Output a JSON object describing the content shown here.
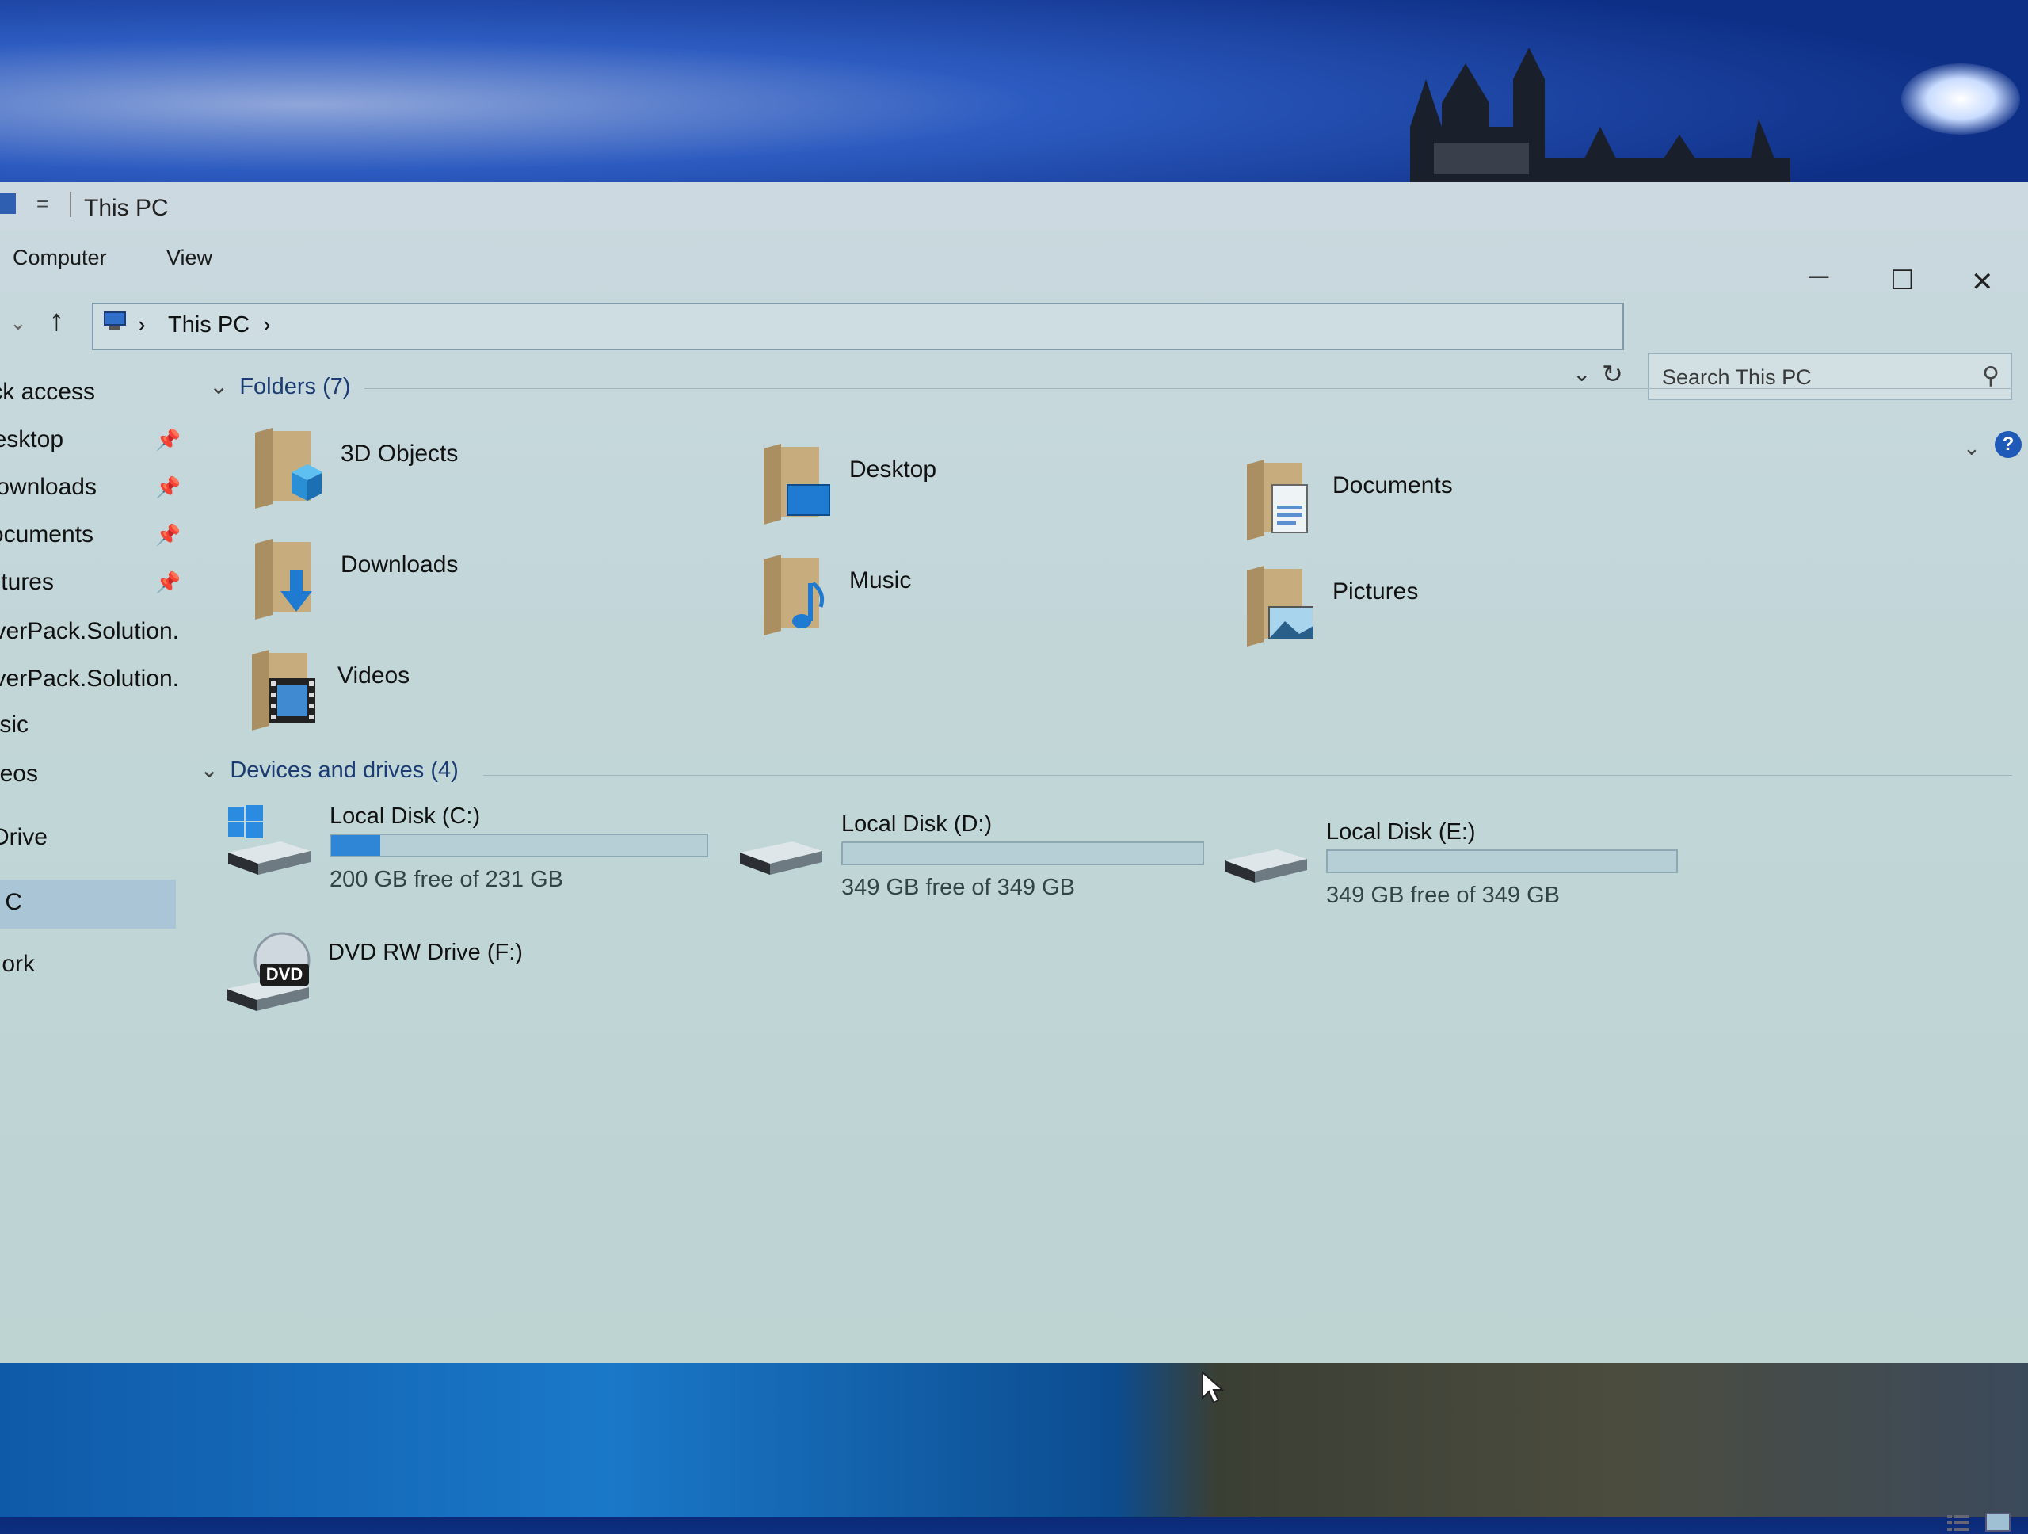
{
  "window": {
    "title": "This PC",
    "quick_access_menu": "=",
    "ribbon_tabs": [
      "Computer",
      "View"
    ],
    "controls": {
      "minimize": "─",
      "maximize": "☐",
      "close": "✕"
    }
  },
  "address": {
    "crumbs": [
      "This PC"
    ],
    "separator": "›",
    "search_placeholder": "Search This PC"
  },
  "sidebar": {
    "items": [
      {
        "label": "ck access",
        "pinned": false
      },
      {
        "label": "esktop",
        "pinned": true
      },
      {
        "label": "ownloads",
        "pinned": true
      },
      {
        "label": "ocuments",
        "pinned": true
      },
      {
        "label": "tures",
        "pinned": true
      },
      {
        "label": "verPack.Solution.",
        "pinned": false
      },
      {
        "label": "verPack.Solution.",
        "pinned": false
      },
      {
        "label": "sic",
        "pinned": false
      },
      {
        "label": "eos",
        "pinned": false
      },
      {
        "label": "Drive",
        "pinned": false
      },
      {
        "label": "C",
        "pinned": false,
        "selected": true
      },
      {
        "label": "ork",
        "pinned": false
      }
    ]
  },
  "folders": {
    "heading": "Folders (7)",
    "items": [
      {
        "label": "3D Objects",
        "icon": "3d-objects-folder-icon"
      },
      {
        "label": "Desktop",
        "icon": "desktop-folder-icon"
      },
      {
        "label": "Documents",
        "icon": "documents-folder-icon"
      },
      {
        "label": "Downloads",
        "icon": "downloads-folder-icon"
      },
      {
        "label": "Music",
        "icon": "music-folder-icon"
      },
      {
        "label": "Pictures",
        "icon": "pictures-folder-icon"
      },
      {
        "label": "Videos",
        "icon": "videos-folder-icon"
      }
    ]
  },
  "drives": {
    "heading": "Devices and drives (4)",
    "items": [
      {
        "name": "Local Disk (C:)",
        "free": "200 GB free of 231 GB",
        "used_fraction": 0.13,
        "icon": "windows-drive-icon"
      },
      {
        "name": "Local Disk (D:)",
        "free": "349 GB free of 349 GB",
        "used_fraction": 0.0,
        "icon": "hard-drive-icon"
      },
      {
        "name": "Local Disk (E:)",
        "free": "349 GB free of 349 GB",
        "used_fraction": 0.0,
        "icon": "hard-drive-icon"
      },
      {
        "name": "DVD RW Drive (F:)",
        "free": "",
        "used_fraction": null,
        "icon": "dvd-drive-icon"
      }
    ],
    "dvd_badge": "DVD"
  },
  "colors": {
    "accent": "#2f86d6",
    "selection": "#a9c5d6",
    "window_bg": "#c2d6d8"
  }
}
